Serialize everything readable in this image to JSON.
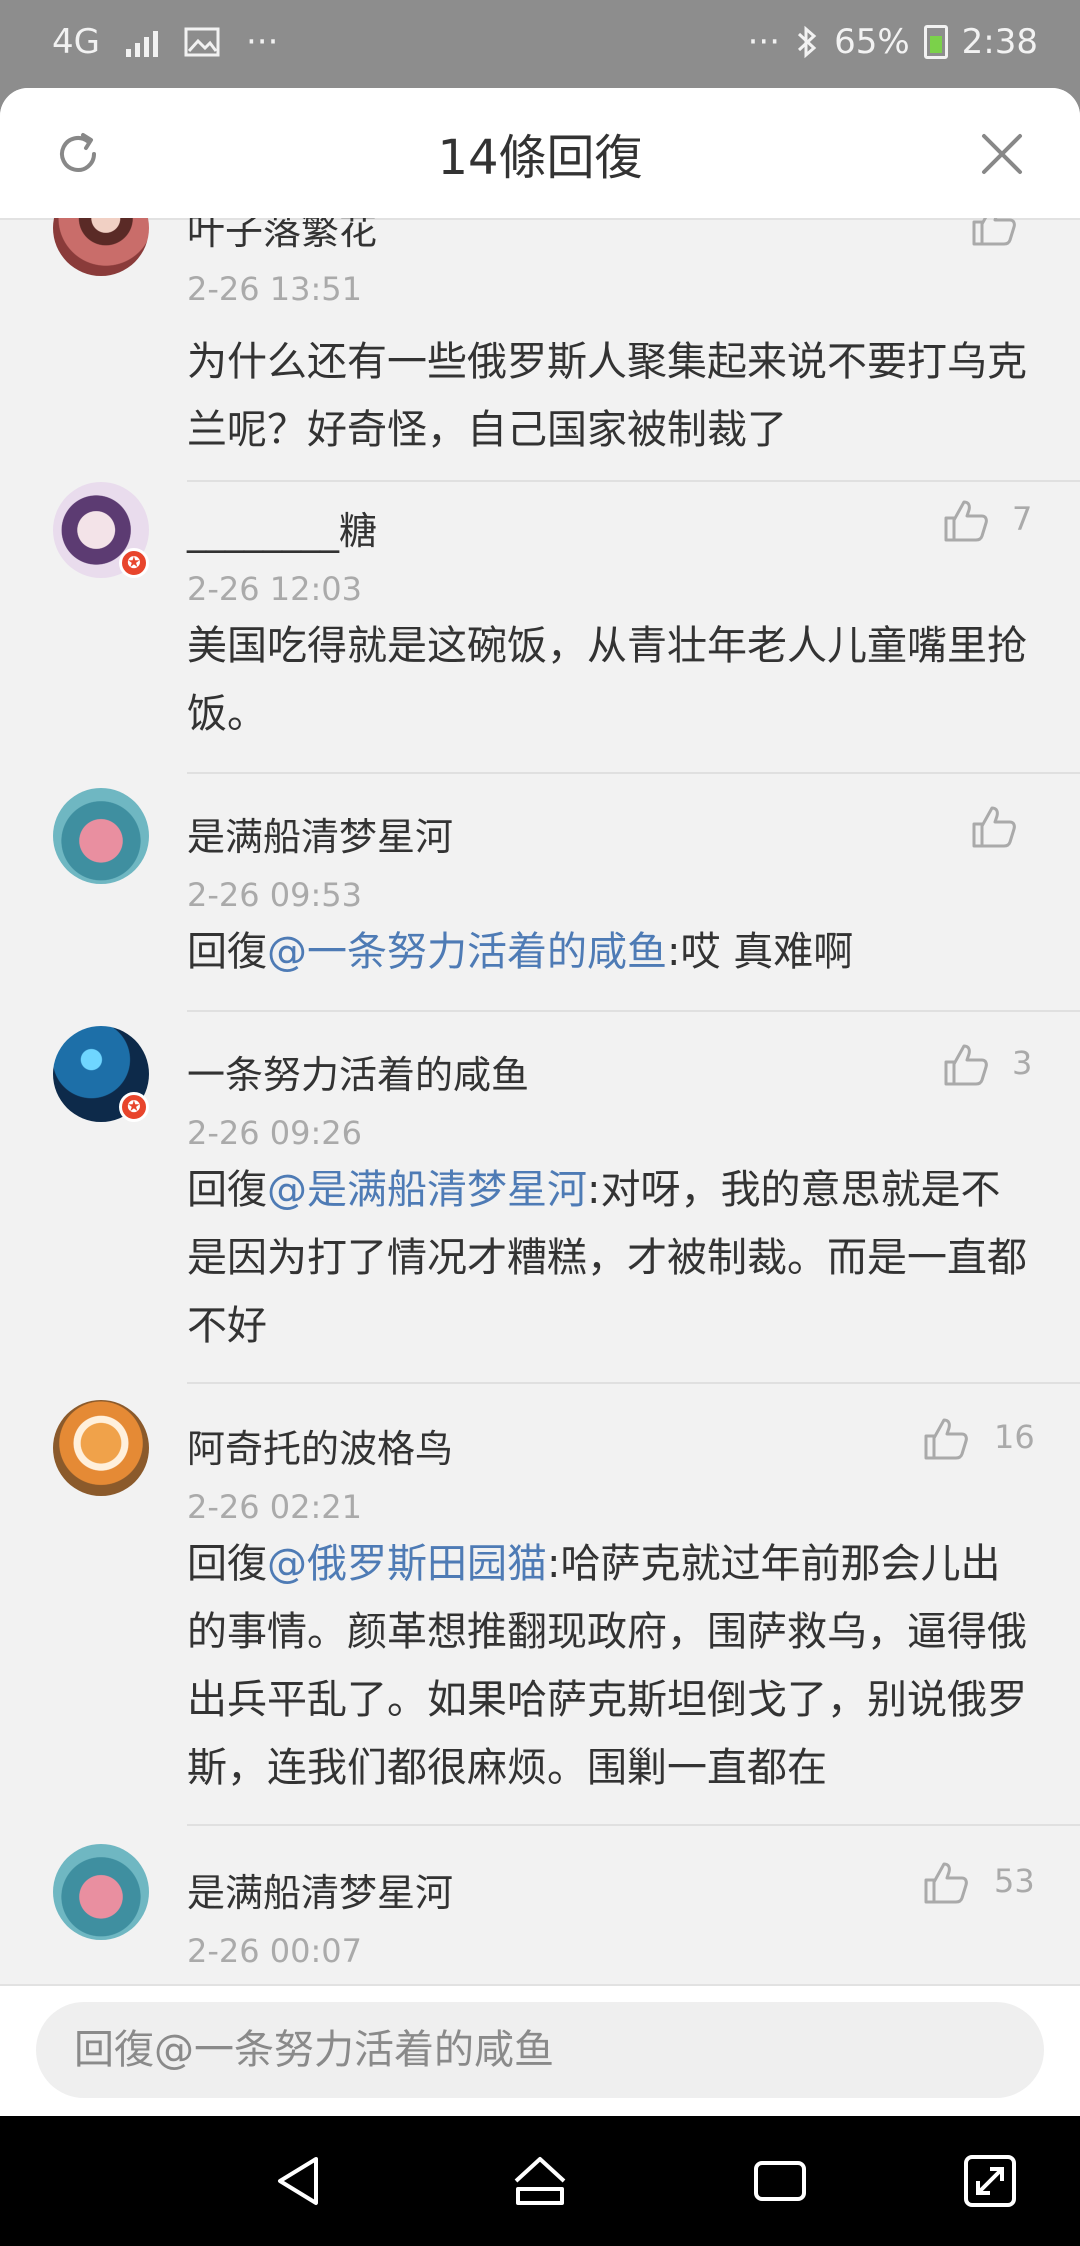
{
  "status_bar": {
    "network": "4G",
    "overflow_left": "···",
    "overflow_right": "···",
    "battery": "65%",
    "time": "2:38"
  },
  "sheet": {
    "title": "14條回復",
    "refresh_icon": "refresh-icon",
    "close_icon": "close-icon"
  },
  "comments": [
    {
      "user": "叶子落繁花",
      "time": "2-26 13:51",
      "likes": "",
      "verified": false,
      "prefix": "",
      "mention": "",
      "text": "为什么还有一些俄罗斯人聚集起来说不要打乌克兰呢？好奇怪，自己国家被制裁了"
    },
    {
      "user": "________糖",
      "time": "2-26 12:03",
      "likes": "7",
      "verified": true,
      "prefix": "",
      "mention": "",
      "text": "美国吃得就是这碗饭，从青壮年老人儿童嘴里抢饭。"
    },
    {
      "user": "是满船清梦星河",
      "time": "2-26 09:53",
      "likes": "",
      "verified": false,
      "prefix": "回復",
      "mention": "@一条努力活着的咸鱼",
      "text": ":哎 真难啊"
    },
    {
      "user": "一条努力活着的咸鱼",
      "time": "2-26 09:26",
      "likes": "3",
      "verified": true,
      "prefix": "回復",
      "mention": "@是满船清梦星河",
      "text": ":对呀，我的意思就是不是因为打了情况才糟糕，才被制裁。而是一直都不好"
    },
    {
      "user": "阿奇托的波格鸟",
      "time": "2-26 02:21",
      "likes": "16",
      "verified": false,
      "prefix": "回復",
      "mention": "@俄罗斯田园猫",
      "text": ":哈萨克就过年前那会儿出的事情。颜革想推翻现政府，围萨救乌，逼得俄出兵平乱了。如果哈萨克斯坦倒戈了，别说俄罗斯，连我们都很麻烦。围剿一直都在"
    },
    {
      "user": "是满船清梦星河",
      "time": "2-26 00:07",
      "likes": "53",
      "verified": false,
      "prefix": "",
      "mention": "",
      "text": ""
    }
  ],
  "reply_input": {
    "placeholder": "回復@一条努力活着的咸鱼"
  },
  "nav_bar": {
    "icons": [
      "back-icon",
      "home-icon",
      "recents-icon",
      "screenshot-icon"
    ]
  },
  "colors": {
    "mention": "#4e7bb5",
    "verified_badge": "#e8452c",
    "battery_fill": "#7bd14a"
  }
}
